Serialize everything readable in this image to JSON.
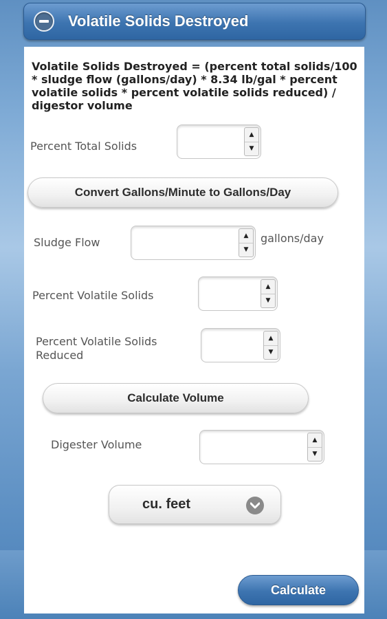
{
  "header": {
    "title": "Volatile Solids Destroyed"
  },
  "formula": "Volatile Solids Destroyed = (percent total solids/100 * sludge flow (gallons/day) * 8.34 lb/gal * percent volatile solids * percent volatile solids reduced) / digestor volume",
  "fields": {
    "percent_total_solids": {
      "label": "Percent Total Solids",
      "value": ""
    },
    "sludge_flow": {
      "label": "Sludge Flow",
      "value": "",
      "unit": "gallons/day"
    },
    "percent_volatile_solids": {
      "label": "Percent Volatile Solids",
      "value": ""
    },
    "percent_volatile_solids_reduced": {
      "label": "Percent Volatile Solids Reduced",
      "value": ""
    },
    "digester_volume": {
      "label": "Digester Volume",
      "value": ""
    }
  },
  "buttons": {
    "convert": "Convert Gallons/Minute to Gallons/Day",
    "calculate_volume": "Calculate Volume",
    "calculate": "Calculate"
  },
  "unit_select": {
    "selected": "cu. feet"
  },
  "icons": {
    "header": "minus-circle-icon",
    "select": "chevron-down-icon",
    "spinner_up": "arrow-up-icon",
    "spinner_down": "arrow-down-icon"
  },
  "colors": {
    "accent": "#3d74b0",
    "panel": "#ffffff"
  }
}
